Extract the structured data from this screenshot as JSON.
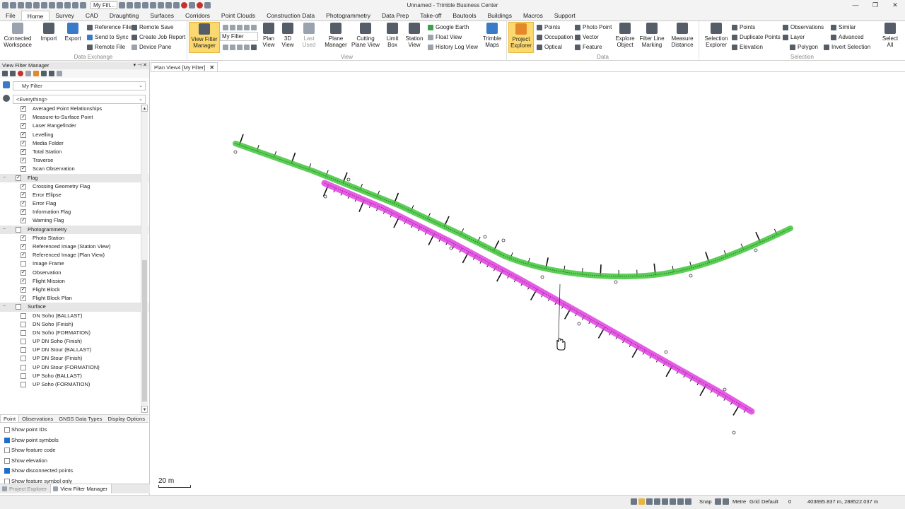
{
  "app": {
    "title": "Unnamed - Trimble Business Center",
    "qat_filter": "My Filt...",
    "window_buttons": [
      "—",
      "❐",
      "✕"
    ]
  },
  "menu_tabs": [
    "File",
    "Home",
    "Survey",
    "CAD",
    "Draughting",
    "Surfaces",
    "Corridors",
    "Point Clouds",
    "Construction Data",
    "Photogrammetry",
    "Data Prep",
    "Take-off",
    "Bautools",
    "Buildings",
    "Macros",
    "Support"
  ],
  "active_tab": "Home",
  "ribbon": {
    "data_exchange": {
      "label": "Data Exchange",
      "connected": "Connected Workspace",
      "import": "Import",
      "export": "Export",
      "reference_file": "Reference File",
      "remote_save": "Remote Save",
      "send_to_sync": "Send to Sync",
      "create_job_report": "Create Job Report",
      "remote_file": "Remote File",
      "device_pane": "Device Pane"
    },
    "view": {
      "label": "View",
      "view_filter_manager": "View Filter Manager",
      "filter_select": "My Filter",
      "plan_view": "Plan View",
      "view_3d": "3D View",
      "last_used": "Last Used",
      "plane_manager": "Plane Manager",
      "cutting_plane_view": "Cutting Plane View",
      "limit_box": "Limit Box",
      "station_view": "Station View",
      "google_earth": "Google Earth",
      "float_view": "Float View",
      "history_log_view": "History Log View",
      "trimble_maps": "Trimble Maps"
    },
    "data": {
      "label": "Data",
      "project_explorer": "Project Explorer",
      "points": "Points",
      "occupation": "Occupation",
      "optical": "Optical",
      "photo_point": "Photo Point",
      "vector": "Vector",
      "feature": "Feature",
      "explore_object": "Explore Object",
      "filter_line_marking": "Filter Line Marking",
      "measure_distance": "Measure Distance"
    },
    "selection": {
      "label": "Selection",
      "selection_explorer": "Selection Explorer",
      "points": "Points",
      "duplicate_points": "Duplicate Points",
      "elevation": "Elevation",
      "observations": "Observations",
      "layer": "Layer",
      "polygon": "Polygon",
      "similar": "Similar",
      "advanced": "Advanced",
      "invert_selection": "Invert Selection",
      "select_all": "Select All"
    }
  },
  "left_panel": {
    "title": "View Filter Manager",
    "filter_value": "My Filter",
    "scope_value": "<Everything>",
    "tree": [
      {
        "label": "Averaged Point Relationships",
        "checked": true,
        "level": 1
      },
      {
        "label": "Measure-to-Surface Point",
        "checked": true,
        "level": 1
      },
      {
        "label": "Laser Rangefinder",
        "checked": true,
        "level": 1
      },
      {
        "label": "Levelling",
        "checked": true,
        "level": 1
      },
      {
        "label": "Media Folder",
        "checked": true,
        "level": 1
      },
      {
        "label": "Total Station",
        "checked": true,
        "level": 1
      },
      {
        "label": "Traverse",
        "checked": true,
        "level": 1
      },
      {
        "label": "Scan Observation",
        "checked": true,
        "level": 1
      },
      {
        "label": "Flag",
        "checked": true,
        "level": 0
      },
      {
        "label": "Crossing Geometry Flag",
        "checked": true,
        "level": 1
      },
      {
        "label": "Error Ellipse",
        "checked": true,
        "level": 1
      },
      {
        "label": "Error Flag",
        "checked": true,
        "level": 1
      },
      {
        "label": "Information Flag",
        "checked": true,
        "level": 1
      },
      {
        "label": "Warning Flag",
        "checked": true,
        "level": 1
      },
      {
        "label": "Photogrammetry",
        "checked": false,
        "level": 0
      },
      {
        "label": "Photo Station",
        "checked": true,
        "level": 1
      },
      {
        "label": "Referenced Image (Station View)",
        "checked": true,
        "level": 1
      },
      {
        "label": "Referenced Image (Plan View)",
        "checked": true,
        "level": 1
      },
      {
        "label": "Image Frame",
        "checked": false,
        "level": 1
      },
      {
        "label": "Observation",
        "checked": true,
        "level": 1
      },
      {
        "label": "Flight Mission",
        "checked": true,
        "level": 1
      },
      {
        "label": "Flight Block",
        "checked": true,
        "level": 1
      },
      {
        "label": "Flight Block Plan",
        "checked": true,
        "level": 1
      },
      {
        "label": "Surface",
        "checked": false,
        "level": 0
      },
      {
        "label": "DN Soho (BALLAST)",
        "checked": false,
        "level": 1
      },
      {
        "label": "DN Soho (Finish)",
        "checked": false,
        "level": 1
      },
      {
        "label": "DN Soho (FORMATION)",
        "checked": false,
        "level": 1
      },
      {
        "label": "UP DN Soho (Finish)",
        "checked": false,
        "level": 1
      },
      {
        "label": "UP DN Stour (BALLAST)",
        "checked": false,
        "level": 1
      },
      {
        "label": "UP DN Stour (Finish)",
        "checked": false,
        "level": 1
      },
      {
        "label": "UP DN Stour (FORMATION)",
        "checked": false,
        "level": 1
      },
      {
        "label": "UP Soho (BALLAST)",
        "checked": false,
        "level": 1
      },
      {
        "label": "UP Soho (FORMATION)",
        "checked": false,
        "level": 1
      }
    ],
    "option_tabs": [
      "Point",
      "Observations",
      "GNSS Data Types",
      "Display Options"
    ],
    "options": [
      {
        "label": "Show point IDs",
        "checked": false
      },
      {
        "label": "Show point symbols",
        "checked": true
      },
      {
        "label": "Show feature code",
        "checked": false
      },
      {
        "label": "Show elevation",
        "checked": false
      },
      {
        "label": "Show disconnected points",
        "checked": true
      },
      {
        "label": "Show feature symbol only",
        "checked": false
      }
    ],
    "bottom_tabs": [
      "Project Explorer",
      "View Filter Manager"
    ]
  },
  "document": {
    "tab_title": "Plan View4 [My Filter]",
    "scale_label": "20 m"
  },
  "colors": {
    "green_alignment": "#3fc53a",
    "magenta_alignment": "#e040e0",
    "ribbon_highlight": "#fbd96f"
  },
  "status": {
    "snap": "Snap",
    "units": "Metre",
    "grid": "Grid",
    "layer": "Default",
    "zero": "0",
    "coords": "403695.837 m, 288522.037 m"
  }
}
